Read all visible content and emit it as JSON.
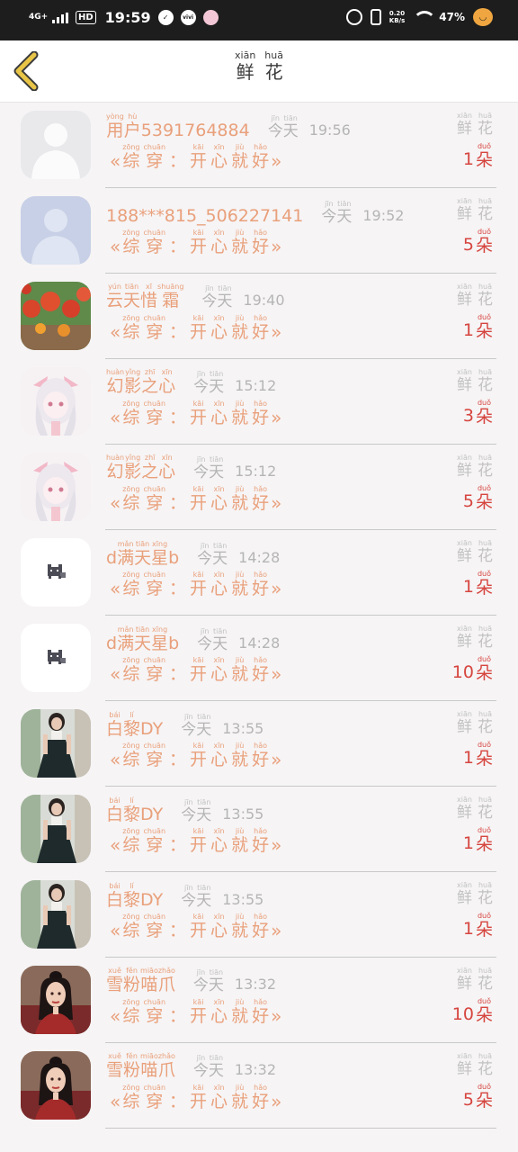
{
  "status_bar": {
    "network": "4G+",
    "hd": "HD",
    "time": "19:59",
    "app_icon_label": "vivi",
    "speed_value": "0.20",
    "speed_unit": "KB/s",
    "battery": "47%"
  },
  "header": {
    "title": [
      {
        "pinyin": "xiān",
        "hanzi": "鲜"
      },
      {
        "pinyin": "huā",
        "hanzi": "花"
      }
    ]
  },
  "labels": {
    "today": [
      {
        "pinyin": "jīn",
        "hanzi": "今"
      },
      {
        "pinyin": "tiān",
        "hanzi": "天"
      }
    ],
    "flower": [
      {
        "pinyin": "xiān",
        "hanzi": "鲜"
      },
      {
        "pinyin": "huā",
        "hanzi": "花"
      }
    ],
    "unit": {
      "pinyin": "duǒ",
      "hanzi": "朵"
    },
    "gift_open": "«",
    "gift_close": "»",
    "gift_phrase": [
      {
        "pinyin": "zōng",
        "hanzi": "综"
      },
      {
        "pinyin": "chuān",
        "hanzi": "穿"
      },
      {
        "pinyin": "",
        "hanzi": "："
      },
      {
        "pinyin": "kāi",
        "hanzi": "开"
      },
      {
        "pinyin": "xīn",
        "hanzi": "心"
      },
      {
        "pinyin": "jiù",
        "hanzi": "就"
      },
      {
        "pinyin": "hǎo",
        "hanzi": "好"
      }
    ]
  },
  "rows": [
    {
      "name": [
        {
          "pinyin": "yòng",
          "hanzi": "用"
        },
        {
          "pinyin": "hù",
          "hanzi": "户"
        },
        {
          "pinyin": "",
          "hanzi": "5391764884"
        }
      ],
      "time": "19:56",
      "count": "1",
      "avatar": "default-gray"
    },
    {
      "name": [
        {
          "pinyin": "",
          "hanzi": "188***815_506227141"
        }
      ],
      "time": "19:52",
      "count": "5",
      "avatar": "default-blue"
    },
    {
      "name": [
        {
          "pinyin": "yún",
          "hanzi": "云"
        },
        {
          "pinyin": "tiān",
          "hanzi": "天"
        },
        {
          "pinyin": "xī",
          "hanzi": "惜"
        },
        {
          "pinyin": "shuāng",
          "hanzi": "霜"
        }
      ],
      "time": "19:40",
      "count": "1",
      "avatar": "lanterns"
    },
    {
      "name": [
        {
          "pinyin": "huàn",
          "hanzi": "幻"
        },
        {
          "pinyin": "yǐng",
          "hanzi": "影"
        },
        {
          "pinyin": "zhī",
          "hanzi": "之"
        },
        {
          "pinyin": "xīn",
          "hanzi": "心"
        }
      ],
      "time": "15:12",
      "count": "3",
      "avatar": "anime-girl"
    },
    {
      "name": [
        {
          "pinyin": "huàn",
          "hanzi": "幻"
        },
        {
          "pinyin": "yǐng",
          "hanzi": "影"
        },
        {
          "pinyin": "zhī",
          "hanzi": "之"
        },
        {
          "pinyin": "xīn",
          "hanzi": "心"
        }
      ],
      "time": "15:12",
      "count": "5",
      "avatar": "anime-girl"
    },
    {
      "name": [
        {
          "pinyin": "",
          "hanzi": "d"
        },
        {
          "pinyin": "mǎn",
          "hanzi": "满"
        },
        {
          "pinyin": "tiān",
          "hanzi": "天"
        },
        {
          "pinyin": "xīng",
          "hanzi": "星"
        },
        {
          "pinyin": "",
          "hanzi": "b"
        }
      ],
      "time": "14:28",
      "count": "1",
      "avatar": "pixel-cat"
    },
    {
      "name": [
        {
          "pinyin": "",
          "hanzi": "d"
        },
        {
          "pinyin": "mǎn",
          "hanzi": "满"
        },
        {
          "pinyin": "tiān",
          "hanzi": "天"
        },
        {
          "pinyin": "xīng",
          "hanzi": "星"
        },
        {
          "pinyin": "",
          "hanzi": "b"
        }
      ],
      "time": "14:28",
      "count": "10",
      "avatar": "pixel-cat"
    },
    {
      "name": [
        {
          "pinyin": "bái",
          "hanzi": "白"
        },
        {
          "pinyin": "lí",
          "hanzi": "黎"
        },
        {
          "pinyin": "",
          "hanzi": "DY"
        }
      ],
      "time": "13:55",
      "count": "1",
      "avatar": "girl-dress"
    },
    {
      "name": [
        {
          "pinyin": "bái",
          "hanzi": "白"
        },
        {
          "pinyin": "lí",
          "hanzi": "黎"
        },
        {
          "pinyin": "",
          "hanzi": "DY"
        }
      ],
      "time": "13:55",
      "count": "1",
      "avatar": "girl-dress"
    },
    {
      "name": [
        {
          "pinyin": "bái",
          "hanzi": "白"
        },
        {
          "pinyin": "lí",
          "hanzi": "黎"
        },
        {
          "pinyin": "",
          "hanzi": "DY"
        }
      ],
      "time": "13:55",
      "count": "1",
      "avatar": "girl-dress"
    },
    {
      "name": [
        {
          "pinyin": "xuě",
          "hanzi": "雪"
        },
        {
          "pinyin": "fěn",
          "hanzi": "粉"
        },
        {
          "pinyin": "miāo",
          "hanzi": "喵"
        },
        {
          "pinyin": "zhǎo",
          "hanzi": "爪"
        }
      ],
      "time": "13:32",
      "count": "10",
      "avatar": "costume-girl"
    },
    {
      "name": [
        {
          "pinyin": "xuě",
          "hanzi": "雪"
        },
        {
          "pinyin": "fěn",
          "hanzi": "粉"
        },
        {
          "pinyin": "miāo",
          "hanzi": "喵"
        },
        {
          "pinyin": "zhǎo",
          "hanzi": "爪"
        }
      ],
      "time": "13:32",
      "count": "5",
      "avatar": "costume-girl"
    }
  ],
  "colors": {
    "accent": "#e9a07b",
    "count": "#d6453f",
    "back_arrow": "#e8c547",
    "muted": "#b5b5b5"
  }
}
